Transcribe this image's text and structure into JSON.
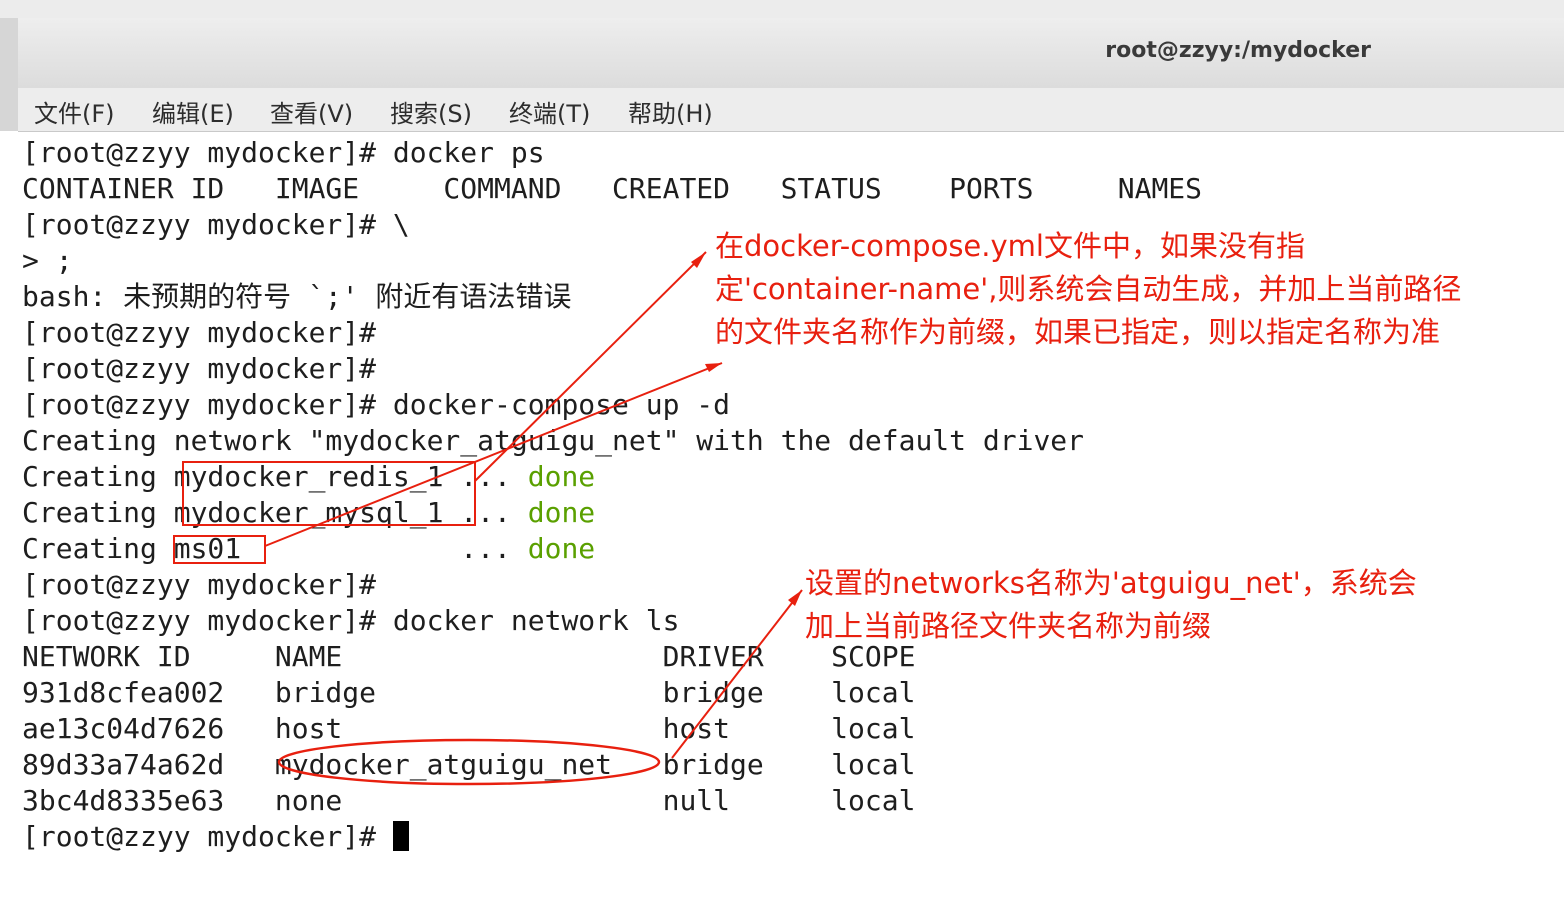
{
  "window": {
    "title": "root@zzyy:/mydocker"
  },
  "menu": [
    {
      "label": "文件(F)"
    },
    {
      "label": "编辑(E)"
    },
    {
      "label": "查看(V)"
    },
    {
      "label": "搜索(S)"
    },
    {
      "label": "终端(T)"
    },
    {
      "label": "帮助(H)"
    }
  ],
  "terminal": {
    "lines": [
      "[root@zzyy mydocker]# docker ps",
      "CONTAINER ID   IMAGE     COMMAND   CREATED   STATUS    PORTS     NAMES",
      "[root@zzyy mydocker]# \\",
      "> ;",
      "bash: 未预期的符号 `;' 附近有语法错误",
      "[root@zzyy mydocker]#",
      "[root@zzyy mydocker]#",
      "[root@zzyy mydocker]# docker-compose up -d",
      "Creating network \"mydocker_atguigu_net\" with the default driver",
      "Creating mydocker_redis_1 ... ",
      "Creating mydocker_mysql_1 ... ",
      "Creating ms01             ... ",
      "[root@zzyy mydocker]#",
      "[root@zzyy mydocker]# docker network ls",
      "NETWORK ID     NAME                   DRIVER    SCOPE",
      "931d8cfea002   bridge                 bridge    local",
      "ae13c04d7626   host                   host      local",
      "89d33a74a62d   mydocker_atguigu_net   bridge    local",
      "3bc4d8335e63   none                   null      local",
      "[root@zzyy mydocker]# "
    ],
    "done_text": "done"
  },
  "annotations": {
    "note1": [
      "在docker-compose.yml文件中，如果没有指",
      "定'container-name',则系统会自动生成，并加上当前路径",
      "的文件夹名称作为前缀，如果已指定，则以指定名称为准"
    ],
    "note2": [
      "设置的networks名称为'atguigu_net'，系统会",
      "加上当前路径文件夹名称为前缀"
    ],
    "color": "#e8200f"
  }
}
